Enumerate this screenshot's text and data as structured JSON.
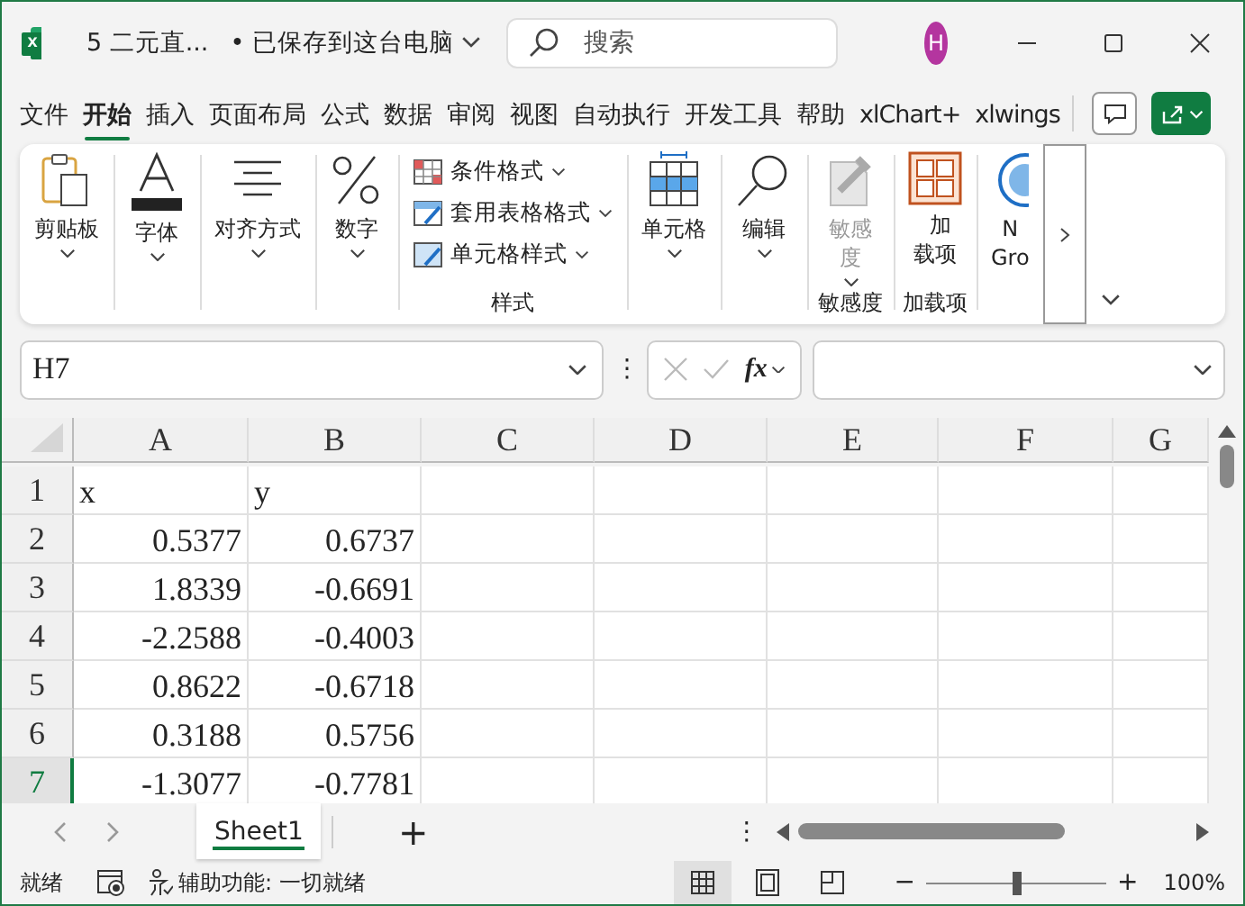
{
  "window": {
    "logo_text": "x",
    "title": "5 二元直...",
    "save_status": "• 已保存到这台电脑"
  },
  "search": {
    "placeholder": "搜索"
  },
  "account": {
    "initial": "H"
  },
  "tabs": [
    {
      "label": "文件",
      "selected": false
    },
    {
      "label": "开始",
      "selected": true
    },
    {
      "label": "插入",
      "selected": false
    },
    {
      "label": "页面布局",
      "selected": false
    },
    {
      "label": "公式",
      "selected": false
    },
    {
      "label": "数据",
      "selected": false
    },
    {
      "label": "审阅",
      "selected": false
    },
    {
      "label": "视图",
      "selected": false
    },
    {
      "label": "自动执行",
      "selected": false
    },
    {
      "label": "开发工具",
      "selected": false
    },
    {
      "label": "帮助",
      "selected": false
    },
    {
      "label": "xlChart+",
      "selected": false
    },
    {
      "label": "xlwings",
      "selected": false
    }
  ],
  "ribbon": {
    "groups": [
      {
        "buttons": [
          {
            "kind": "large",
            "label": "剪贴板",
            "dropdown": true,
            "disabled": false
          }
        ]
      },
      {
        "buttons": [
          {
            "kind": "large",
            "label": "字体",
            "dropdown": true,
            "disabled": false
          }
        ]
      },
      {
        "buttons": [
          {
            "kind": "large",
            "label": "对齐方式",
            "dropdown": true,
            "disabled": false
          }
        ]
      },
      {
        "buttons": [
          {
            "kind": "large",
            "label": "数字",
            "dropdown": true,
            "disabled": false
          }
        ]
      },
      {
        "label": "样式",
        "buttons": [
          {
            "kind": "small",
            "label": "条件格式",
            "dropdown": true,
            "disabled": false
          },
          {
            "kind": "small",
            "label": "套用表格格式",
            "dropdown": true,
            "disabled": false
          },
          {
            "kind": "small",
            "label": "单元格样式",
            "dropdown": true,
            "disabled": false
          }
        ]
      },
      {
        "buttons": [
          {
            "kind": "large",
            "label": "单元格",
            "dropdown": true,
            "disabled": false
          }
        ]
      },
      {
        "buttons": [
          {
            "kind": "large",
            "label": "编辑",
            "dropdown": true,
            "disabled": false
          }
        ]
      },
      {
        "label": "敏感度",
        "buttons": [
          {
            "kind": "narrow",
            "label": "敏感度",
            "dropdown": true,
            "disabled": true
          }
        ]
      },
      {
        "label": "加载项",
        "buttons": [
          {
            "kind": "indented",
            "label": "加载项",
            "dropdown": false,
            "disabled": false
          }
        ]
      },
      {
        "buttons": [
          {
            "kind": "large",
            "label": "N\nGro",
            "dropdown": false,
            "disabled": false
          }
        ]
      }
    ]
  },
  "formula_bar": {
    "name_box": "H7",
    "more": "⋮",
    "function_label": "fx"
  },
  "sheet": {
    "columns": [
      "A",
      "B",
      "C",
      "D",
      "E",
      "F",
      "G"
    ],
    "rows": [
      {
        "header": "1",
        "selected": false,
        "cells": [
          {
            "text": "x",
            "kind": "text"
          },
          {
            "text": "y",
            "kind": "text"
          }
        ]
      },
      {
        "header": "2",
        "selected": false,
        "cells": [
          {
            "text": "0.5377",
            "kind": "number"
          },
          {
            "text": "0.6737",
            "kind": "number"
          }
        ]
      },
      {
        "header": "3",
        "selected": false,
        "cells": [
          {
            "text": "1.8339",
            "kind": "number"
          },
          {
            "text": "-0.6691",
            "kind": "number"
          }
        ]
      },
      {
        "header": "4",
        "selected": false,
        "cells": [
          {
            "text": "-2.2588",
            "kind": "number"
          },
          {
            "text": "-0.4003",
            "kind": "number"
          }
        ]
      },
      {
        "header": "5",
        "selected": false,
        "cells": [
          {
            "text": "0.8622",
            "kind": "number"
          },
          {
            "text": "-0.6718",
            "kind": "number"
          }
        ]
      },
      {
        "header": "6",
        "selected": false,
        "cells": [
          {
            "text": "0.3188",
            "kind": "number"
          },
          {
            "text": "0.5756",
            "kind": "number"
          }
        ]
      },
      {
        "header": "7",
        "selected": true,
        "cells": [
          {
            "text": "-1.3077",
            "kind": "number"
          },
          {
            "text": "-0.7781",
            "kind": "number"
          }
        ]
      }
    ]
  },
  "sheet_tabs": {
    "tabs": [
      {
        "label": "Sheet1",
        "selected": true
      }
    ],
    "add": "+",
    "more": "⋮"
  },
  "status_bar": {
    "status": "就绪",
    "accessibility": "辅助功能: 一切就绪",
    "views": [
      {
        "selected": true
      },
      {
        "selected": false
      },
      {
        "selected": false
      }
    ],
    "zoom": {
      "minus": "−",
      "plus": "+",
      "level": 0.5,
      "reading": "100%"
    }
  }
}
